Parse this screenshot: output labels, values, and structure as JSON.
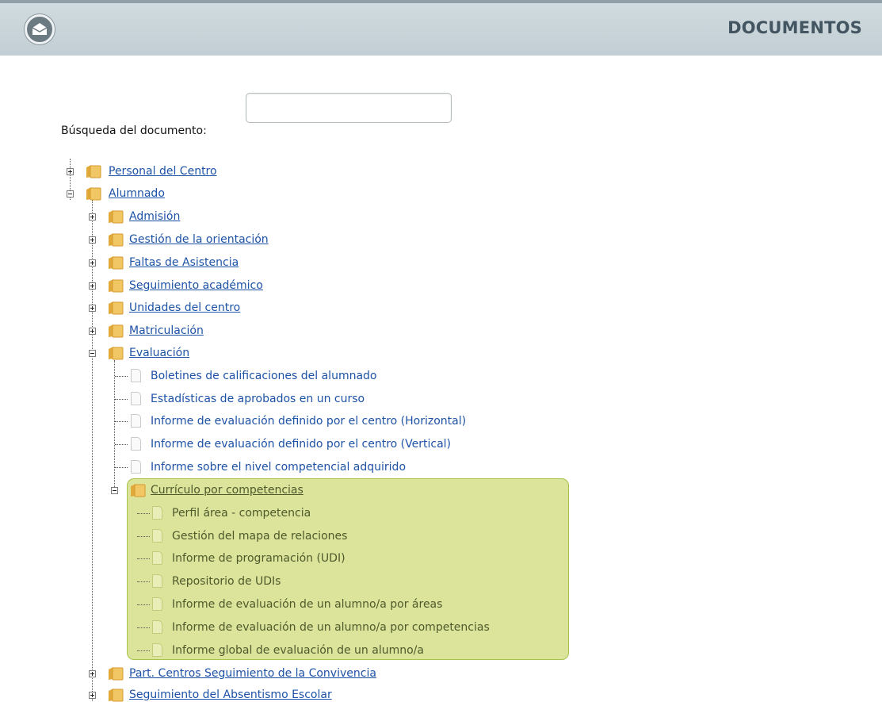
{
  "header": {
    "title": "DOCUMENTOS",
    "mail_icon": "mail-icon"
  },
  "search": {
    "label": "Búsqueda del documento:",
    "value": "",
    "placeholder": ""
  },
  "tree": {
    "personal": "Personal del Centro",
    "alumnado": "Alumnado",
    "alumnado_children": {
      "admision": "Admisión",
      "orientacion": "Gestión de la orientación",
      "faltas": "Faltas de Asistencia",
      "seguimiento": "Seguimiento académico",
      "unidades": "Unidades del centro",
      "matriculacion": "Matriculación",
      "evaluacion": "Evaluación",
      "convivencia": "Part. Centros Seguimiento de la Convivencia",
      "absentismo": "Seguimiento del Absentismo Escolar"
    },
    "evaluacion_docs": [
      "Boletines de calificaciones del alumnado",
      "Estadísticas de aprobados en un curso",
      "Informe de evaluación definido por el centro (Horizontal)",
      "Informe de evaluación definido por el centro (Vertical)",
      "Informe sobre el nivel competencial adquirido"
    ],
    "curriculo": {
      "label": "Currículo por competencias",
      "docs": [
        "Perfil área - competencia",
        "Gestión del mapa de relaciones",
        "Informe de programación (UDI)",
        "Repositorio de UDIs",
        "Informe de evaluación de un alumno/a por áreas",
        "Informe de evaluación de un alumno/a por competencias",
        "Informe global de evaluación de un alumno/a"
      ]
    }
  },
  "colors": {
    "header_bg": "#c8d3d8",
    "title": "#435560",
    "link": "#1d52a6",
    "highlight_bg": "#dce39a",
    "highlight_border": "#a7c34a"
  }
}
